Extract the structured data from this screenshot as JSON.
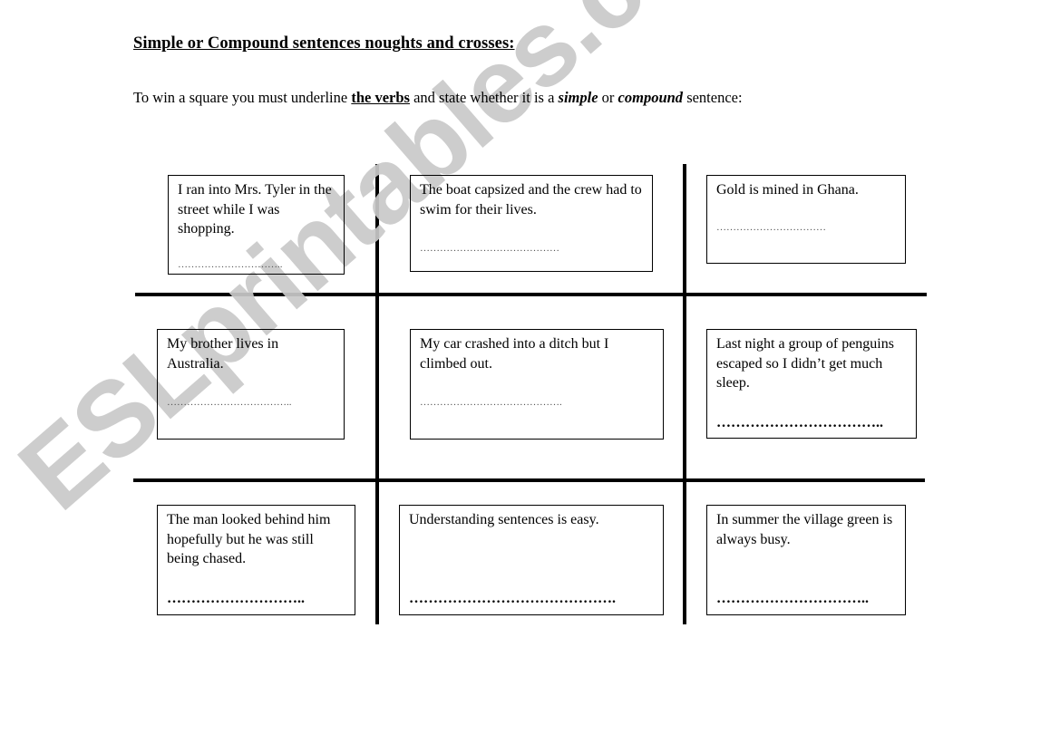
{
  "title": "Simple or Compound sentences noughts and crosses:",
  "instructions": {
    "prefix": "To win a square you must underline ",
    "keyword": "the verbs",
    "middle": " and state whether it is a ",
    "option1": "simple",
    "or": " or ",
    "option2": "compound",
    "suffix": " sentence:"
  },
  "watermark": "ESLprintables.com",
  "grid": {
    "cells": [
      {
        "sentence": "I ran into Mrs. Tyler in the street while I was shopping.",
        "answer_line": "………………………….."
      },
      {
        "sentence": "The boat capsized and the crew had to swim for their lives.",
        "answer_line": "……………………………………"
      },
      {
        "sentence": "Gold is mined in Ghana.",
        "answer_line": "……………………………"
      },
      {
        "sentence": "My brother lives in Australia.",
        "answer_line": "……………………………….."
      },
      {
        "sentence": "My car crashed into a ditch but I climbed out.",
        "answer_line": "……………………………………."
      },
      {
        "sentence": "Last night a group of penguins escaped so I didn’t get much sleep.",
        "answer_line": "…………………………….."
      },
      {
        "sentence": "The man looked behind him hopefully but he was still being chased.",
        "answer_line": "……………………….."
      },
      {
        "sentence": "Understanding sentences is easy.",
        "answer_line": "……………………………………."
      },
      {
        "sentence": "In summer the village green is always busy.",
        "answer_line": "………………………….."
      }
    ]
  }
}
